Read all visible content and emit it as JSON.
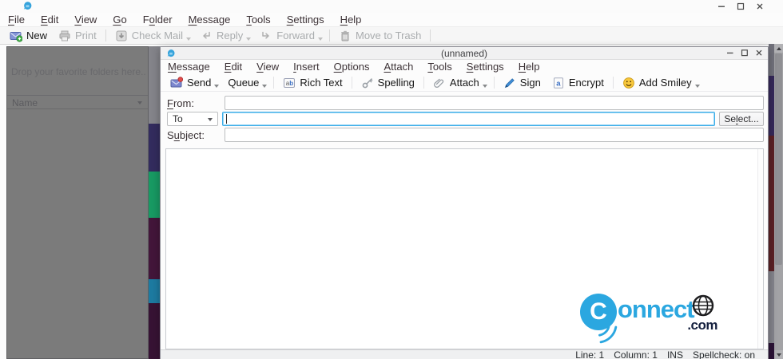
{
  "main_window": {
    "menu": [
      {
        "label": "File",
        "m": 0
      },
      {
        "label": "Edit",
        "m": 0
      },
      {
        "label": "View",
        "m": 0
      },
      {
        "label": "Go",
        "m": 0
      },
      {
        "label": "Folder",
        "m": 1
      },
      {
        "label": "Message",
        "m": 0
      },
      {
        "label": "Tools",
        "m": 0
      },
      {
        "label": "Settings",
        "m": 0
      },
      {
        "label": "Help",
        "m": 0
      }
    ],
    "toolbar": [
      {
        "label": "New",
        "icon": "mail-new-icon",
        "enabled": true
      },
      {
        "label": "Print",
        "icon": "printer-icon",
        "enabled": false,
        "sep_after": true
      },
      {
        "label": "Check Mail",
        "icon": "check-mail-icon",
        "enabled": false,
        "dropdown": true
      },
      {
        "label": "Reply",
        "icon": "reply-icon",
        "enabled": false,
        "dropdown": true
      },
      {
        "label": "Forward",
        "icon": "forward-icon",
        "enabled": false,
        "dropdown": true,
        "sep_after": true
      },
      {
        "label": "Move to Trash",
        "icon": "trash-icon",
        "enabled": false,
        "sep_after": true
      }
    ],
    "sidebar": {
      "favorites_placeholder": "Drop your favorite folders here...",
      "folders_header": "Name"
    }
  },
  "compose_window": {
    "title": "(unnamed)",
    "menu": [
      {
        "label": "Message",
        "m": 0
      },
      {
        "label": "Edit",
        "m": 0
      },
      {
        "label": "View",
        "m": 0
      },
      {
        "label": "Insert",
        "m": 0
      },
      {
        "label": "Options",
        "m": 0
      },
      {
        "label": "Attach",
        "m": 0
      },
      {
        "label": "Tools",
        "m": 0
      },
      {
        "label": "Settings",
        "m": 0
      },
      {
        "label": "Help",
        "m": 0
      }
    ],
    "toolbar": [
      {
        "label": "Send",
        "icon": "send-icon",
        "enabled": true,
        "dropdown": true
      },
      {
        "label": "Queue",
        "icon": null,
        "enabled": true,
        "dropdown": true,
        "sep_after": true
      },
      {
        "label": "Rich Text",
        "icon": "richtext-icon",
        "enabled": true,
        "sep_after": true
      },
      {
        "label": "Spelling",
        "icon": "spelling-icon",
        "enabled": true,
        "sep_after": true
      },
      {
        "label": "Attach",
        "icon": "attach-icon",
        "enabled": true,
        "dropdown": true,
        "sep_after": true
      },
      {
        "label": "Sign",
        "icon": "sign-icon",
        "enabled": true
      },
      {
        "label": "Encrypt",
        "icon": "encrypt-icon",
        "enabled": true,
        "sep_after": true
      },
      {
        "label": "Add Smiley",
        "icon": "smiley-icon",
        "enabled": true,
        "dropdown": true
      }
    ],
    "form": {
      "from_label": {
        "label": "From:",
        "m": 0
      },
      "to_selector": {
        "label": "To"
      },
      "select_button": {
        "label": "Select...",
        "m": 2
      },
      "subject_label": {
        "label": "Subject:",
        "m": 1
      },
      "from_value": "",
      "to_value": "",
      "subject_value": ""
    },
    "statusbar": {
      "line": "Line: 1",
      "column": "Column: 1",
      "mode": "INS",
      "spellcheck": "Spellcheck: on"
    },
    "watermark": {
      "c": "C",
      "rest": "onnect",
      "tld": ".com"
    }
  },
  "colors": {
    "focus_accent": "#3daee9",
    "logo_blue": "#2ba7e0",
    "logo_navy": "#16213f",
    "sidebar_gray": "#7b7b7b",
    "wallpaper_bands_left": [
      "#84848a",
      "#332c5e",
      "#189a63",
      "#43163a",
      "#1d7ba1",
      "#371334"
    ],
    "wallpaper_bands_right": [
      "#71717b",
      "#36295a",
      "#5c2125",
      "#84848c",
      "#2c1337"
    ]
  }
}
